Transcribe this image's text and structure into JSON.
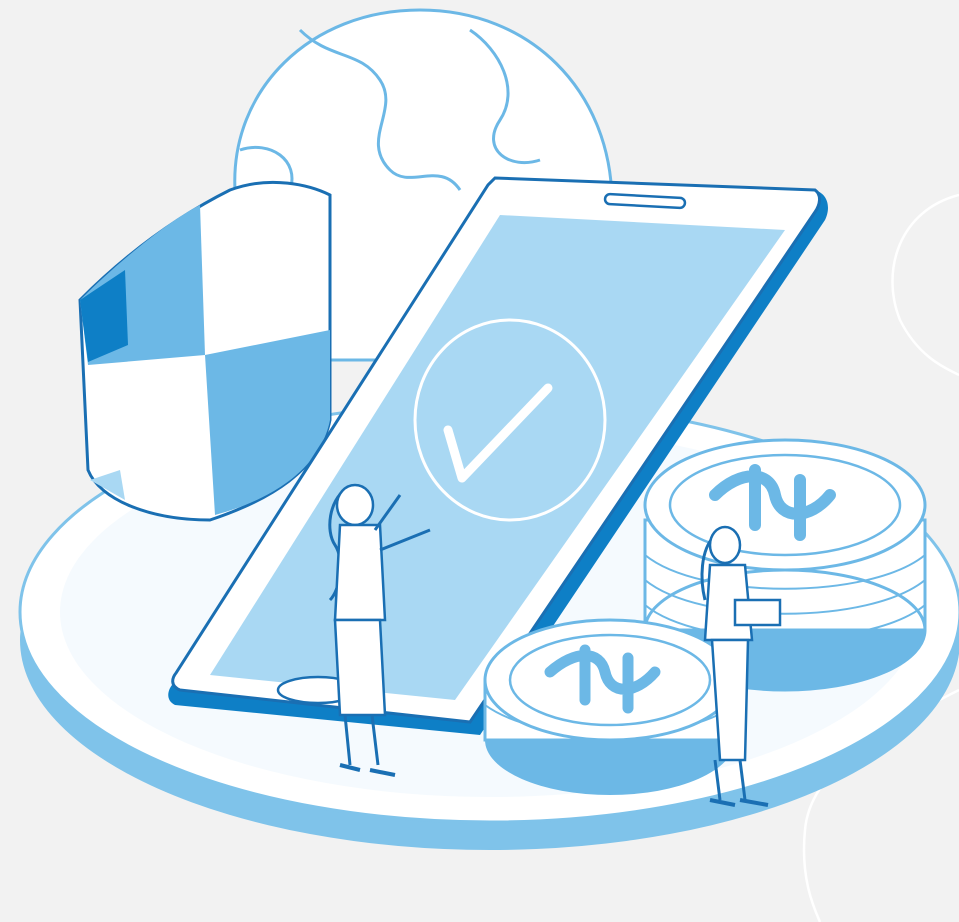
{
  "colors": {
    "background": "#f2f2f2",
    "light_blue": "#a9d8f3",
    "mid_blue": "#6cb8e6",
    "deep_blue": "#0e7fc6",
    "outline": "#1a6fb3",
    "white": "#ffffff"
  },
  "icons": {
    "shield": "shield-icon",
    "globe": "globe-icon",
    "phone": "smartphone-icon",
    "checkmark": "checkmark-icon",
    "coin_symbol": "currency-symbol-icon"
  }
}
